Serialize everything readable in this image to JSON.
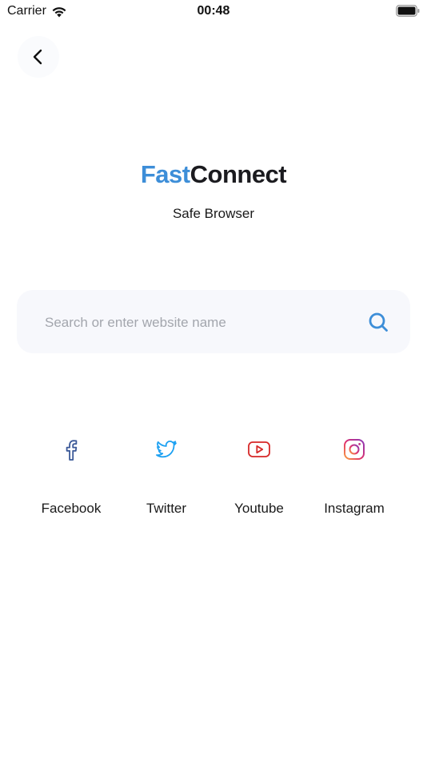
{
  "status_bar": {
    "carrier": "Carrier",
    "time": "00:48",
    "wifi_icon": "wifi-icon",
    "battery_icon": "battery-icon"
  },
  "nav": {
    "back_icon": "chevron-left-icon"
  },
  "brand": {
    "logo_part1": "Fast",
    "logo_part2": "Connect",
    "tagline": "Safe Browser",
    "colors": {
      "fast": "#3d8ed8",
      "connect": "#1b1b1f"
    }
  },
  "search": {
    "value": "",
    "placeholder": "Search or enter website name",
    "icon": "search-icon",
    "icon_color": "#3d8ed8"
  },
  "quick_links": [
    {
      "label": "Facebook",
      "icon": "facebook-icon",
      "color": "#3b5998"
    },
    {
      "label": "Twitter",
      "icon": "twitter-icon",
      "color": "#1da1f2"
    },
    {
      "label": "Youtube",
      "icon": "youtube-icon",
      "color": "#d62828"
    },
    {
      "label": "Instagram",
      "icon": "instagram-icon",
      "color": "#e1306c"
    }
  ]
}
